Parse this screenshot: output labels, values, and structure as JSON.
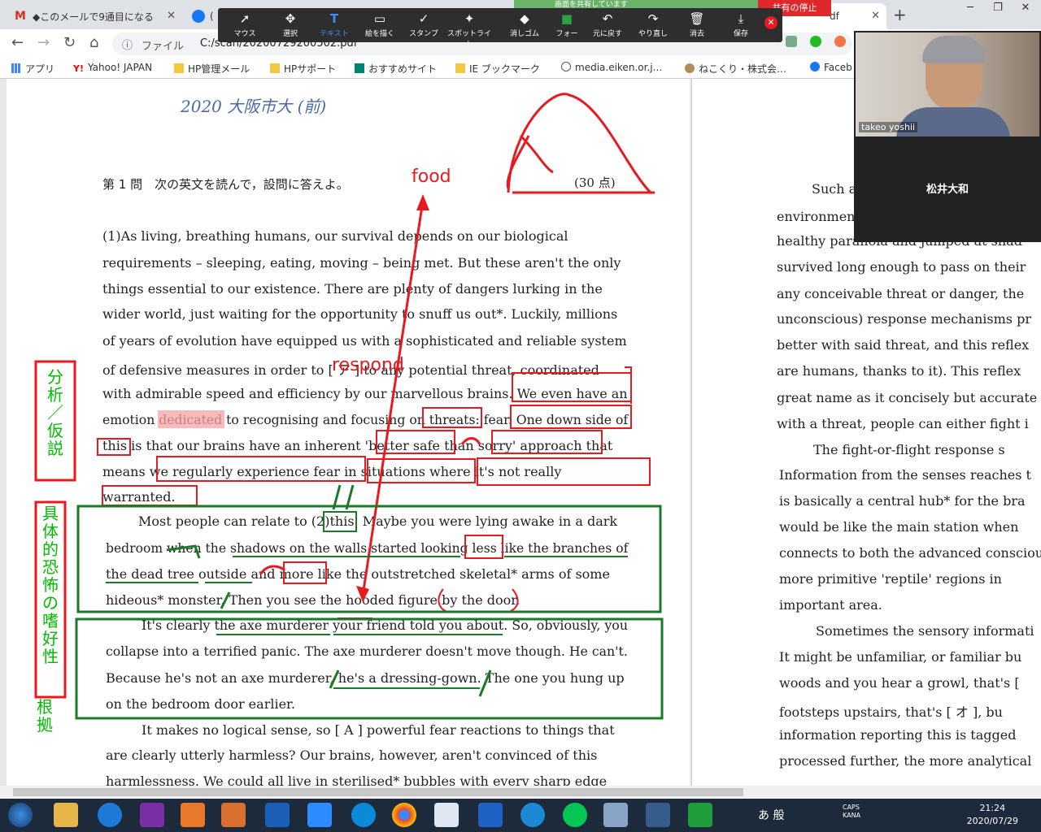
{
  "browser": {
    "tabs": [
      {
        "title": "◆このメールで9通目になる",
        "icon": "gmail-icon"
      },
      {
        "title": "(",
        "icon": "facebook-icon"
      },
      {
        "title": "df",
        "icon": "pdf-icon"
      }
    ],
    "omnibox": {
      "scheme": "ファイル",
      "url": "C:/scan/20200729200502.pdf"
    },
    "bookmarks": [
      "アプリ",
      "Yahoo! JAPAN",
      "HP管理メール",
      "HPサポート",
      "おすすめサイト",
      "IE ブックマーク",
      "media.eiken.or.j…",
      "ねこくり・株式会…",
      "Faceb"
    ]
  },
  "annotate": {
    "tools": [
      "マウス",
      "選択",
      "テキスト",
      "絵を描く",
      "スタンプ",
      "スポットライト",
      "消しゴム",
      "フォー",
      "元に戻す",
      "やり直し",
      "消去",
      "保存"
    ],
    "stop_share": "共有の停止",
    "sharing_text": "画面を共有しています"
  },
  "zoom": {
    "participant1": "takeo yoshii",
    "participant2": "松井大和"
  },
  "pdf": {
    "handwritten_header": "2020 大阪市大 (前)",
    "question_title": "第 1 問　次の英文を読んで，設問に答えよ。",
    "points": "(30 点)",
    "main_lines": [
      "(1)As  living,  breathing  humans,  our  survival  depends  on  our  biological",
      "requirements – sleeping, eating, moving – being met. But these aren't the only",
      "things essential to our existence. There are plenty of dangers lurking in the",
      "wider world, just waiting for the opportunity to snuff us out*. Luckily, millions",
      "of years of evolution have equipped us with a sophisticated and reliable system",
      "of defensive measures in order to [  ア  ] to any potential threat, coordinated",
      "with admirable speed and efficiency by our marvellous brains. We even have an",
      "emotion dedicated to recognising and focusing on threats: fear. One down side of",
      "this is that our brains have an inherent 'better safe than sorry' approach that",
      "means  we  regularly  experience  fear  in  situations  where  it's  not  really",
      "warranted.",
      "Most people can relate to (2)this. Maybe you were lying awake in a dark",
      "bedroom when the shadows on the walls started looking less like the branches of",
      "the dead tree outside and more like the outstretched skeletal* arms of some",
      "hideous* monster. Then you see the hooded figure by the door.",
      "It's clearly the axe murderer your friend told you about. So, obviously, you",
      "collapse into a terrified panic. The axe murderer doesn't move though. He can't.",
      "Because he's not an axe murderer, he's a dressing-gown. The one you hung up",
      "on the bedroom door earlier.",
      "It makes no logical sense, so [  A  ] powerful fear reactions to things that",
      "are clearly utterly harmless? Our brains, however, aren't convinced of this",
      "harmlessness. We could all live in sterilised* bubbles with every sharp edge"
    ],
    "right_lines": [
      "Such a",
      "environment",
      "healthy paranoia and jumped at shad",
      "survived long enough to pass on their",
      "any conceivable threat or danger, the",
      "unconscious) response mechanisms pr",
      "better with said threat, and this reflex",
      "are humans, thanks to it). This reflex",
      "great name as it concisely but accurate",
      "with a threat, people can either fight i",
      "The  fight-or-flight  response  s",
      "Information from the senses reaches t",
      "is basically a central hub* for the bra",
      "would be like the main station when",
      "connects to both the advanced consciou",
      "more primitive 'reptile' regions  in",
      "important area.",
      "Sometimes the sensory informati",
      "It might be unfamiliar, or familiar bu",
      "woods and you hear a growl, that's [",
      "footsteps upstairs, that's [  オ  ], bu",
      "information reporting this is tagged",
      "processed further, the more analytical"
    ],
    "marks": {
      "food": "food",
      "respond": "respond",
      "label_analysis": "分析／仮説",
      "label_concrete": "具体的恐怖の嗜好性",
      "label_basis": "根拠"
    }
  },
  "taskbar": {
    "ime": "あ 般",
    "caps": "CAPS KANA",
    "time": "21:24",
    "date": "2020/07/29"
  },
  "colors": {
    "red": "#e8191f",
    "green": "#1b7a2a",
    "highlight": "#f6a3a3"
  }
}
